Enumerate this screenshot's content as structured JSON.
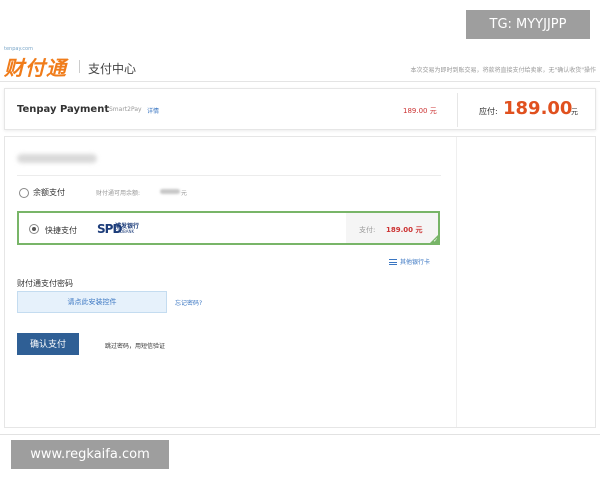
{
  "overlays": {
    "tg_badge": "TG: MYYJJPP",
    "watermark": "www.regkaifa.com"
  },
  "header": {
    "logo_tagline": "tenpay.com",
    "logo_text": "财付通",
    "title": "支付中心",
    "notice": "本次交易为即时到账交易，将款将直接支付给卖家，无\"确认收货\"操作"
  },
  "summary": {
    "brand": "Tenpay Payment",
    "product": "Smart2Pay",
    "detail_link": "详情",
    "price": "189.00 元",
    "due_label": "应付:",
    "due_amount": "189.00",
    "due_unit": "元"
  },
  "payment": {
    "balance_option": {
      "label": "余额支付",
      "note": "财付通可用余额:",
      "unit": "元",
      "selected": false
    },
    "quick_option": {
      "label": "快捷支付",
      "bank_name": "浦发银行",
      "bank_en": "SPDBANK",
      "bank_mark": "SPD",
      "pay_label": "支付:",
      "pay_amount": "189.00 元",
      "selected": true,
      "check_mark": "✓"
    },
    "other_cards": "其他银行卡",
    "password_label": "财付通支付密码",
    "password_prompt": "请点此安装控件",
    "forgot_password": "忘记密码?",
    "confirm_button": "确认支付",
    "skip_link": "跳过密码，用短信验证"
  },
  "colors": {
    "brand_orange": "#f07c1a",
    "amount_red": "#e0501e",
    "selected_green": "#78b568",
    "link_blue": "#3a76c2",
    "button_blue": "#2f5f95"
  }
}
